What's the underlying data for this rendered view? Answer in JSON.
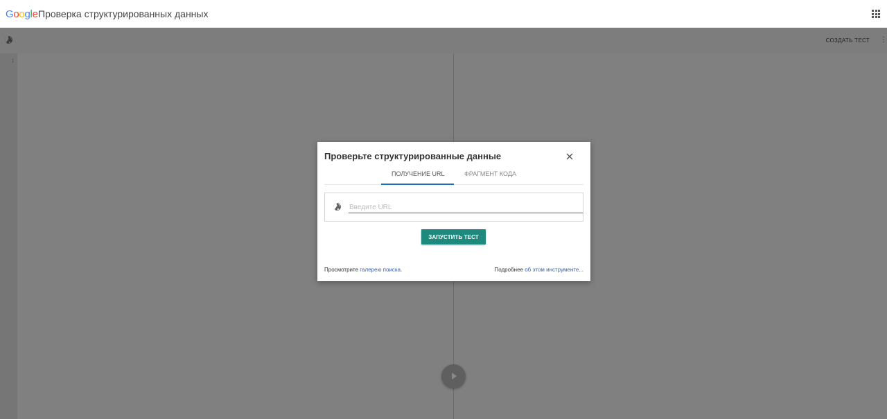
{
  "header": {
    "logo_letters": [
      "G",
      "o",
      "o",
      "g",
      "l",
      "e"
    ],
    "logo_colors": [
      "#4285F4",
      "#EA4335",
      "#FBBC05",
      "#4285F4",
      "#34A853",
      "#EA4335"
    ],
    "title": "Проверка структурированных данных",
    "apps_icon": "apps-grid-icon"
  },
  "toolbar": {
    "globe_icon": "globe-icon",
    "create_test_label": "СОЗДАТЬ ТЕСТ",
    "more_label": "⋮"
  },
  "editor": {
    "line_number": "1",
    "run_icon": "play-icon"
  },
  "dialog": {
    "title": "Проверьте структурированные данные",
    "close_icon": "close-icon",
    "tabs": [
      {
        "label": "ПОЛУЧЕНИЕ URL",
        "active": true
      },
      {
        "label": "ФРАГМЕНТ КОДА",
        "active": false
      }
    ],
    "url_input": {
      "placeholder": "Введите URL",
      "value": ""
    },
    "run_button_label": "ЗАПУСТИТЬ ТЕСТ",
    "footer_left": {
      "text": "Просмотрите ",
      "link": "галерею поиска."
    },
    "footer_right": {
      "text": "Подробнее ",
      "link": "об этом инструменте..."
    }
  },
  "colors": {
    "accent_blue": "#1a73b8",
    "run_button": "#1e8a7d",
    "link": "#3b62b0",
    "overlay_dim": "#808080"
  }
}
